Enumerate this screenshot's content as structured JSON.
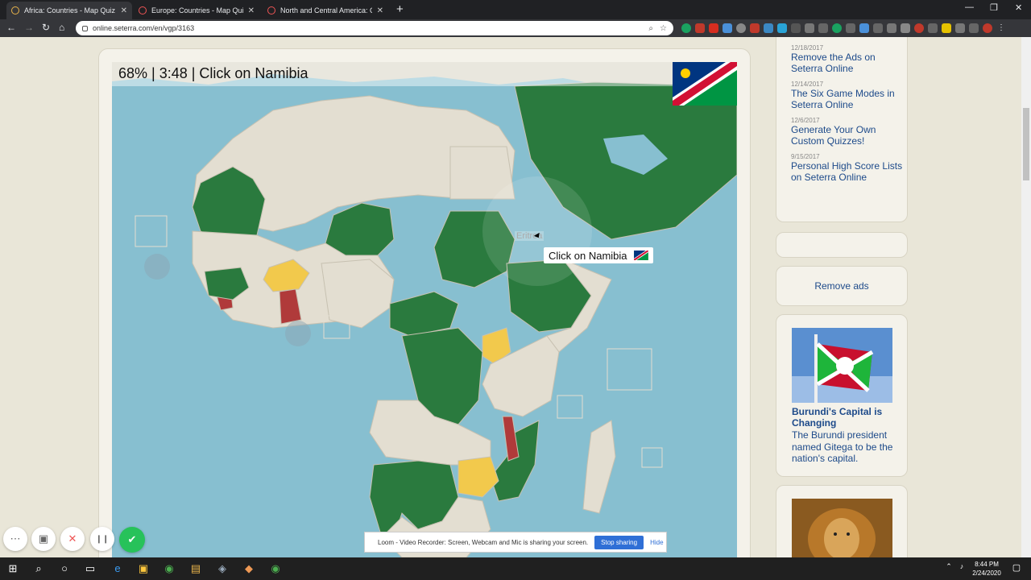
{
  "browser": {
    "tabs": [
      {
        "title": "Africa: Countries - Map Quiz Ga",
        "active": true
      },
      {
        "title": "Europe: Countries - Map Quiz Ga",
        "active": false
      },
      {
        "title": "North and Central America: Cou",
        "active": false
      }
    ],
    "url": "online.seterra.com/en/vgp/3163",
    "new_tab": "+",
    "window_controls": [
      "—",
      "❐",
      "✕"
    ]
  },
  "quiz": {
    "status": "68% | 3:48 | Click on Namibia",
    "tooltip": "Click on Namibia",
    "hover_label": "Eritrea",
    "flag_country": "Namibia"
  },
  "sidebar": {
    "news": [
      {
        "date": "12/18/2017",
        "title": "Remove the Ads on Seterra Online"
      },
      {
        "date": "12/14/2017",
        "title": "The Six Game Modes in Seterra Online"
      },
      {
        "date": "12/6/2017",
        "title": "Generate Your Own Custom Quizzes!"
      },
      {
        "date": "9/15/2017",
        "title": "Personal High Score Lists on Seterra Online"
      }
    ],
    "remove_ads": "Remove ads",
    "promo": {
      "title": "Burundi's Capital is Changing",
      "body": "The Burundi president named Gitega to be the nation's capital."
    }
  },
  "loom": {
    "message": "Loom - Video Recorder: Screen, Webcam and Mic is sharing your screen.",
    "stop": "Stop sharing",
    "hide": "Hide",
    "controls": [
      "⋯",
      "▣",
      "✕",
      "❙❙",
      "✔"
    ]
  },
  "taskbar": {
    "time": "8:44 PM",
    "date": "2/24/2020"
  },
  "colors": {
    "map_water": "#87bfd0",
    "land_neutral": "#e3ded1",
    "correct_green": "#2a7a3e",
    "wrong_red": "#b03a3a",
    "retry_yellow": "#f2c94c",
    "link_blue": "#1d4a8a"
  }
}
